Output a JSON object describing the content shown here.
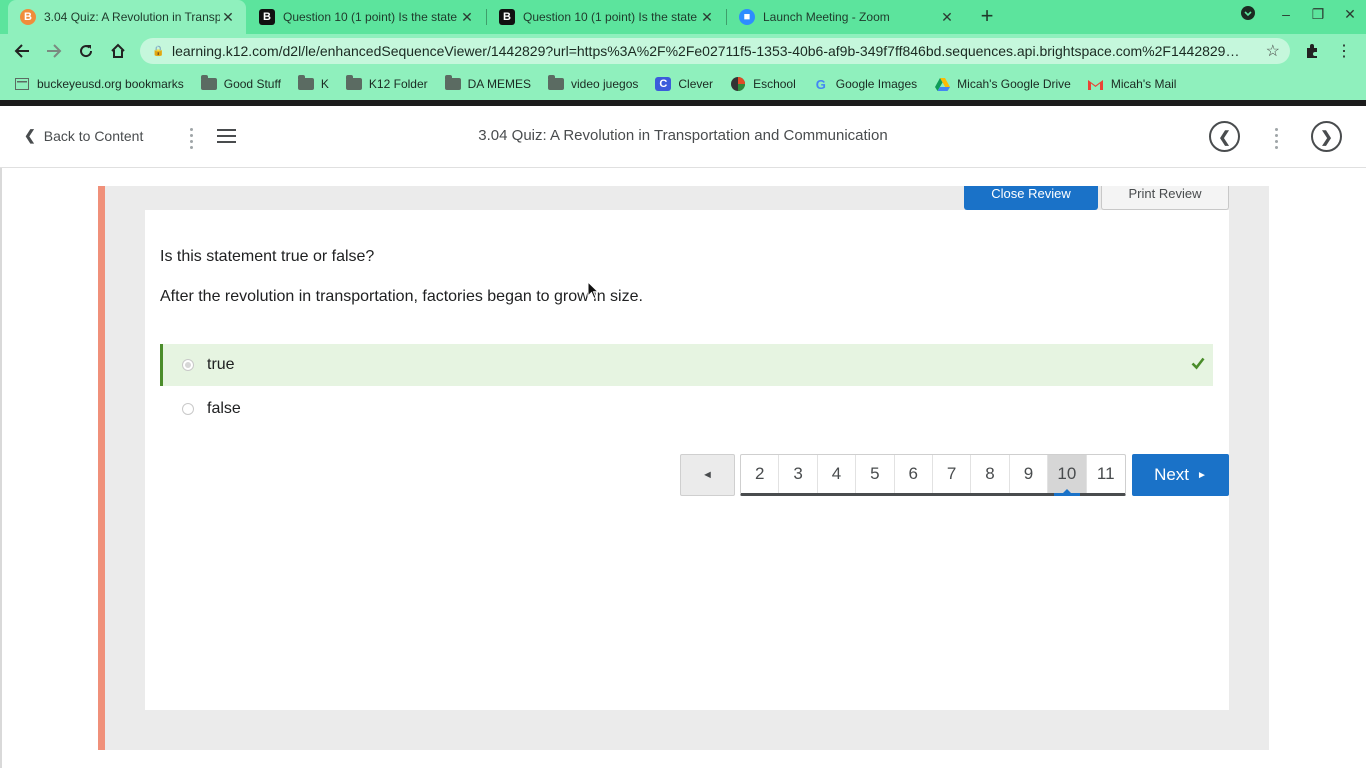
{
  "browser": {
    "tabs": [
      {
        "title": "3.04 Quiz: A Revolution in Transp",
        "favicon": "brightspace-icon",
        "active": true
      },
      {
        "title": "Question 10 (1 point) Is the state",
        "favicon": "b-icon",
        "active": false
      },
      {
        "title": "Question 10 (1 point) Is the state",
        "favicon": "b-icon",
        "active": false
      },
      {
        "title": "Launch Meeting - Zoom",
        "favicon": "zoom-icon",
        "active": false
      }
    ],
    "url": "learning.k12.com/d2l/le/enhancedSequenceViewer/1442829?url=https%3A%2F%2Fe02711f5-1353-40b6-af9b-349f7ff846bd.sequences.api.brightspace.com%2F1442829…",
    "bookmarks": [
      {
        "label": "buckeyeusd.org bookmarks",
        "icon": "page-icon"
      },
      {
        "label": "Good Stuff",
        "icon": "folder-icon"
      },
      {
        "label": "K",
        "icon": "folder-icon"
      },
      {
        "label": "K12 Folder",
        "icon": "folder-icon"
      },
      {
        "label": "DA MEMES",
        "icon": "folder-icon"
      },
      {
        "label": "video juegos",
        "icon": "folder-icon"
      },
      {
        "label": "Clever",
        "icon": "clever-icon"
      },
      {
        "label": "Eschool",
        "icon": "eschool-icon"
      },
      {
        "label": "Google Images",
        "icon": "google-icon"
      },
      {
        "label": "Micah's Google Drive",
        "icon": "drive-icon"
      },
      {
        "label": "Micah's Mail",
        "icon": "gmail-icon"
      }
    ],
    "colors": {
      "tabstrip": "#5ce49d",
      "toolbar": "#8ff0bd"
    }
  },
  "header": {
    "back_label": "Back to Content",
    "title": "3.04 Quiz: A Revolution in Transportation and Communication"
  },
  "review": {
    "close_label": "Close Review",
    "print_label": "Print Review"
  },
  "question": {
    "prompt": "Is this statement true or false?",
    "statement": "After the revolution in transportation, factories began to grow in size.",
    "answers": [
      {
        "label": "true",
        "selected": true,
        "correct": true
      },
      {
        "label": "false",
        "selected": false,
        "correct": false
      }
    ]
  },
  "pagination": {
    "prev_symbol": "◄",
    "pages": [
      "2",
      "3",
      "4",
      "5",
      "6",
      "7",
      "8",
      "9",
      "10",
      "11"
    ],
    "current": "10",
    "next_label": "Next",
    "next_symbol": "►"
  },
  "colors": {
    "accent_blue": "#1a72c8",
    "correct_green": "#4a8c2a",
    "correct_bg": "#e6f4e1",
    "panel_stripe": "#f0907a"
  }
}
